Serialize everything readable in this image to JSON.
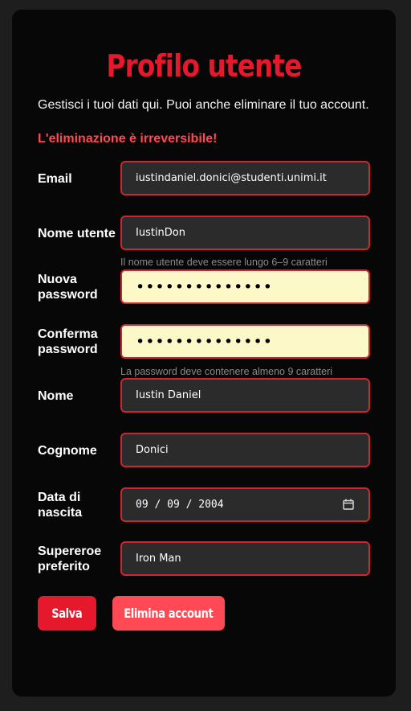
{
  "page": {
    "title": "Profilo utente",
    "intro": "Gestisci i tuoi dati qui. Puoi anche eliminare il tuo account.",
    "warning": "L'eliminazione è irreversibile!"
  },
  "form": {
    "email": {
      "label": "Email",
      "value": "iustindaniel.donici@studenti.unimi.it"
    },
    "username": {
      "label": "Nome utente",
      "value": "IustinDon",
      "hint": "Il nome utente deve essere lungo 6–9 caratteri"
    },
    "new_password": {
      "label": "Nuova password",
      "value": "••••••••••••••"
    },
    "confirm_password": {
      "label": "Conferma password",
      "value": "••••••••••••••",
      "hint": "La password deve contenere almeno 9 caratteri"
    },
    "first_name": {
      "label": "Nome",
      "value": "Iustin Daniel"
    },
    "last_name": {
      "label": "Cognome",
      "value": "Donici"
    },
    "birth_date": {
      "label": "Data di nascita",
      "value": "09 / 09 / 2004"
    },
    "superhero": {
      "label": "Supereroe preferito",
      "value": "Iron Man"
    }
  },
  "buttons": {
    "save": "Salva",
    "delete": "Elimina account"
  },
  "colors": {
    "accent": "#e5182c",
    "danger": "#ff4a55",
    "field_border": "#d0242f",
    "autofill": "#fdf8c8"
  },
  "icons": {
    "date_picker": "calendar-icon"
  }
}
